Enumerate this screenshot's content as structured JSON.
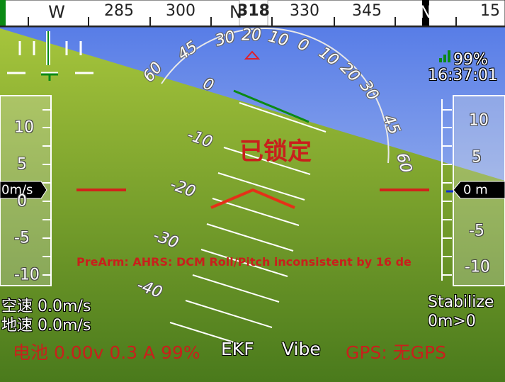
{
  "heading": {
    "labels": [
      {
        "text": "W",
        "cardinal": true
      },
      {
        "text": "285"
      },
      {
        "text": "300"
      },
      {
        "text": "N"
      },
      {
        "text": "330"
      },
      {
        "text": "345"
      },
      {
        "text": "N",
        "cardinal": true
      },
      {
        "text": "15"
      }
    ],
    "current": "318"
  },
  "roll_scale": [
    "60",
    "45",
    "30",
    "20",
    "10",
    "0",
    "10",
    "20",
    "30",
    "45",
    "60"
  ],
  "pitch_ladder": [
    "0",
    "-10",
    "-20",
    "-30",
    "-40"
  ],
  "speed_tape": {
    "ticks": [
      "10",
      "5",
      "0",
      "-5",
      "-10"
    ],
    "current": "0m/s"
  },
  "alt_tape": {
    "ticks": [
      "10",
      "5",
      "-5",
      "-10"
    ],
    "current": "0 m"
  },
  "status": {
    "armed_state": "已锁定",
    "message": "PreArm: AHRS: DCM Roll/Pitch inconsistent by 16 de",
    "battery_link": "99%",
    "time": "16:37:01"
  },
  "left_info": {
    "airspeed": "空速 0.0m/s",
    "groundspeed": "地速 0.0m/s"
  },
  "right_info": {
    "mode": "Stabilize",
    "distance": "0m>0"
  },
  "bottom_bar": {
    "battery": "电池 0.00v 0.3 A 99%",
    "ekf": "EKF",
    "vibe": "Vibe",
    "gps": "GPS: 无GPS"
  },
  "colors": {
    "sky_top": "#5b7fe8",
    "sky_bottom": "#b9cdf0",
    "ground_top": "#a3c23a",
    "ground_bottom": "#4e7c1e",
    "warning_red": "#c8201c",
    "horizon_green": "#0b8a14"
  }
}
